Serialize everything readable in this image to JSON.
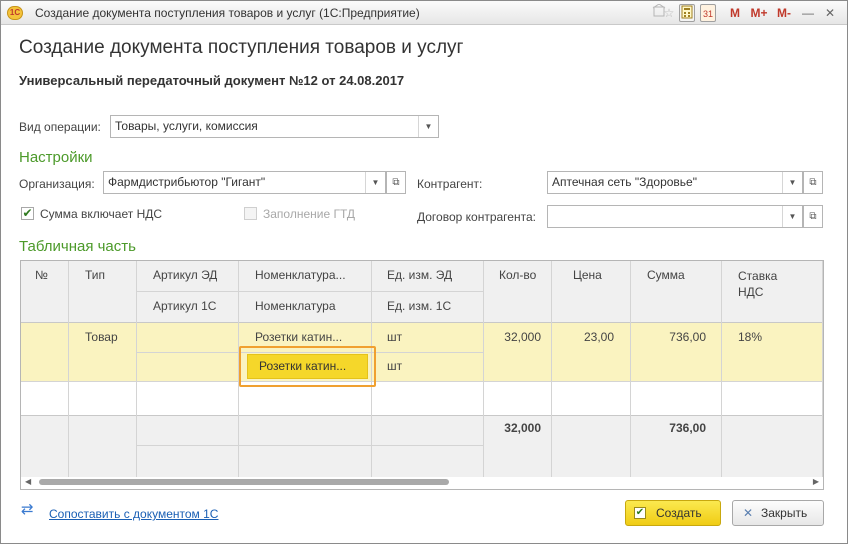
{
  "window": {
    "app_logo": "1С",
    "title": "Создание документа поступления товаров и услуг  (1С:Предприятие)",
    "controls": {
      "m": "M",
      "m_plus": "M+",
      "m_minus": "M-",
      "minimize": "—",
      "close": "✕",
      "calendar_day": "31"
    }
  },
  "page": {
    "title": "Создание документа поступления товаров и услуг",
    "doc_heading": "Универсальный передаточный документ №12 от 24.08.2017"
  },
  "form": {
    "operation_label": "Вид операции:",
    "operation_value": "Товары, услуги, комиссия",
    "settings_title": "Настройки",
    "organization_label": "Организация:",
    "organization_value": "Фармдистрибьютор \"Гигант\"",
    "counterparty_label": "Контрагент:",
    "counterparty_value": "Аптечная сеть \"Здоровье\"",
    "vat_label": "Сумма включает НДС",
    "vat_checked": true,
    "gtd_label": "Заполнение ГТД",
    "gtd_checked": false,
    "contract_label": "Договор контрагента:",
    "contract_value": "",
    "table_title": "Табличная часть"
  },
  "grid": {
    "headers": {
      "num": "№",
      "type": "Тип",
      "article_ed": "Артикул ЭД",
      "article_1c": "Артикул 1С",
      "nomenclature_ed": "Номенклатура...",
      "nomenclature_1c": "Номенклатура",
      "unit_ed": "Ед. изм. ЭД",
      "unit_1c": "Ед. изм. 1С",
      "qty": "Кол-во",
      "price": "Цена",
      "sum": "Сумма",
      "vat_rate": "Ставка НДС"
    },
    "rows": [
      {
        "num": "",
        "type": "Товар",
        "article_ed": "",
        "article_1c": "",
        "nomenclature_ed": "Розетки катин...",
        "nomenclature_1c": "Розетки катин...",
        "unit_ed": "шт",
        "unit_1c": "шт",
        "qty": "32,000",
        "price": "23,00",
        "sum": "736,00",
        "vat_rate": "18%"
      }
    ],
    "totals": {
      "qty": "32,000",
      "sum": "736,00"
    }
  },
  "footer": {
    "link_text": "Сопоставить с документом 1С",
    "create_label": "Создать",
    "close_label": "Закрыть"
  },
  "colors": {
    "accent_green": "#4c9a2a",
    "row_highlight": "#faf3c0",
    "active_cell": "#f5d72a",
    "active_border": "#f0a030",
    "primary_button": "#f0cc14",
    "link": "#1a5fb4"
  }
}
